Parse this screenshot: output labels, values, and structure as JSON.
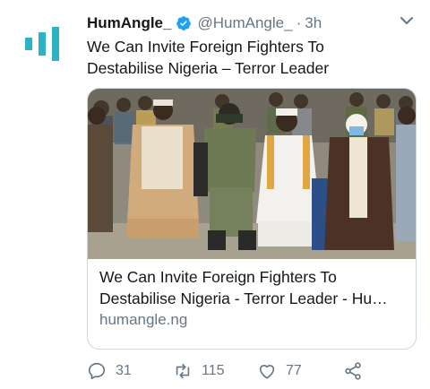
{
  "tweet": {
    "author_name": "HumAngle_",
    "author_handle": "@HumAngle_",
    "separator": "·",
    "timestamp": "3h",
    "text_lines": [
      "We Can Invite Foreign Fighters To",
      "Destabilise Nigeria – Terror Leader"
    ],
    "brand_color": "#2bb3c5",
    "verified_color": "#1da1f2"
  },
  "card": {
    "image_alt": "Group of men seated outdoors, including an armed man in camouflage",
    "title_lines": [
      "We Can Invite Foreign Fighters To",
      "Destabilise Nigeria - Terror Leader - Hu…"
    ],
    "domain": "humangle.ng"
  },
  "actions": {
    "reply_count": "31",
    "retweet_count": "115",
    "like_count": "77",
    "icons": [
      "reply-icon",
      "retweet-icon",
      "like-icon",
      "share-icon"
    ]
  }
}
